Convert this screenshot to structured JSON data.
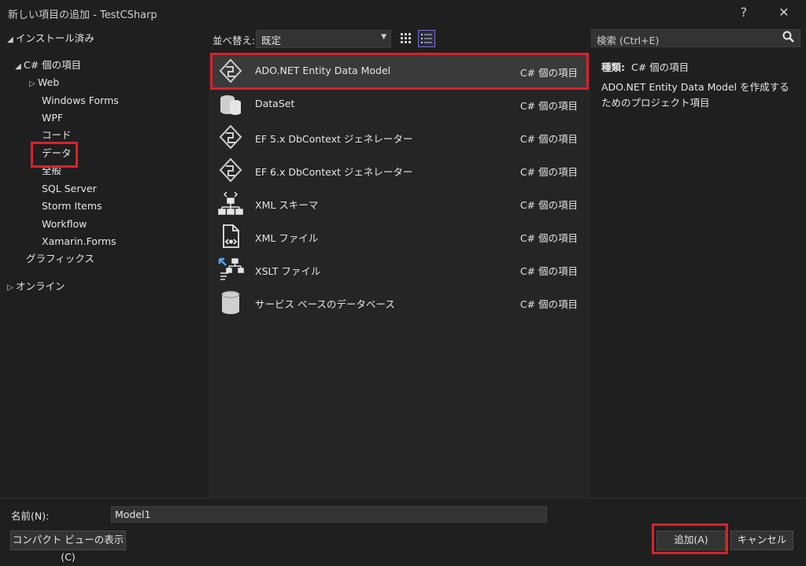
{
  "window": {
    "title": "新しい項目の追加 - TestCSharp",
    "help": "?",
    "close": "✕"
  },
  "sidebar": {
    "installed": "インストール済み",
    "csharp": "C# 個の項目",
    "items": [
      "Web",
      "Windows Forms",
      "WPF",
      "コード",
      "データ",
      "全般",
      "SQL Server",
      "Storm Items",
      "Workflow",
      "Xamarin.Forms"
    ],
    "graphics": "グラフィックス",
    "online": "オンライン"
  },
  "toolbar": {
    "sort_label": "並べ替え:",
    "sort_value": "既定"
  },
  "templates": [
    {
      "name": "ADO.NET Entity Data Model",
      "category": "C# 個の項目",
      "icon": "entity-model-icon"
    },
    {
      "name": "DataSet",
      "category": "C# 個の項目",
      "icon": "dataset-icon"
    },
    {
      "name": "EF 5.x DbContext ジェネレーター",
      "category": "C# 個の項目",
      "icon": "dbcontext-generator-icon"
    },
    {
      "name": "EF 6.x DbContext ジェネレーター",
      "category": "C# 個の項目",
      "icon": "dbcontext-generator-icon"
    },
    {
      "name": "XML スキーマ",
      "category": "C# 個の項目",
      "icon": "xml-schema-icon"
    },
    {
      "name": "XML ファイル",
      "category": "C# 個の項目",
      "icon": "xml-file-icon"
    },
    {
      "name": "XSLT ファイル",
      "category": "C# 個の項目",
      "icon": "xslt-file-icon"
    },
    {
      "name": "サービス ベースのデータベース",
      "category": "C# 個の項目",
      "icon": "database-icon"
    }
  ],
  "search": {
    "placeholder": "検索 (Ctrl+E)"
  },
  "details": {
    "type_label": "種類:",
    "type_value": "C# 個の項目",
    "description": "ADO.NET Entity Data Model を作成するためのプロジェクト項目"
  },
  "footer": {
    "name_label": "名前(N):",
    "name_value": "Model1",
    "compact_view": "コンパクト ビューの表示(C)",
    "add": "追加(A)",
    "cancel": "キャンセル"
  },
  "colors": {
    "highlight": "#d9222a",
    "selected_row": "#3a3a3a",
    "accent": "#7c6ccf"
  }
}
